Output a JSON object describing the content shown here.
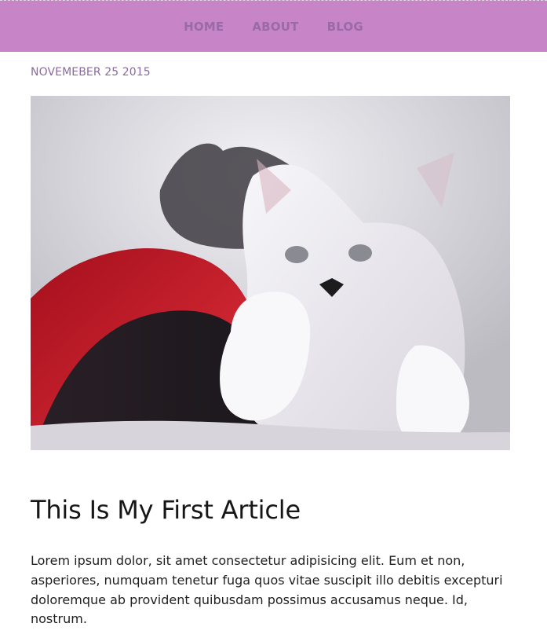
{
  "nav": {
    "items": [
      {
        "label": "HOME"
      },
      {
        "label": "ABOUT"
      },
      {
        "label": "BLOG"
      }
    ]
  },
  "article": {
    "date": "NOVEMEBER 25 2015",
    "title": "This Is My First Article",
    "body": "Lorem ipsum dolor, sit amet consectetur adipisicing elit. Eum et non, asperiores, numquam tenetur fuga quos vitae suscipit illo debitis excepturi doloremque ab provident quibusdam possimus accusamus neque. Id, nostrum."
  },
  "image": {
    "alt": "two kittens lying on a bed with a red blanket"
  },
  "colors": {
    "header_background": "#c785c8",
    "nav_text": "#9a6aa7",
    "date_text": "#8a6aa0",
    "title_text": "#161616",
    "body_text": "#1f1f1f"
  }
}
